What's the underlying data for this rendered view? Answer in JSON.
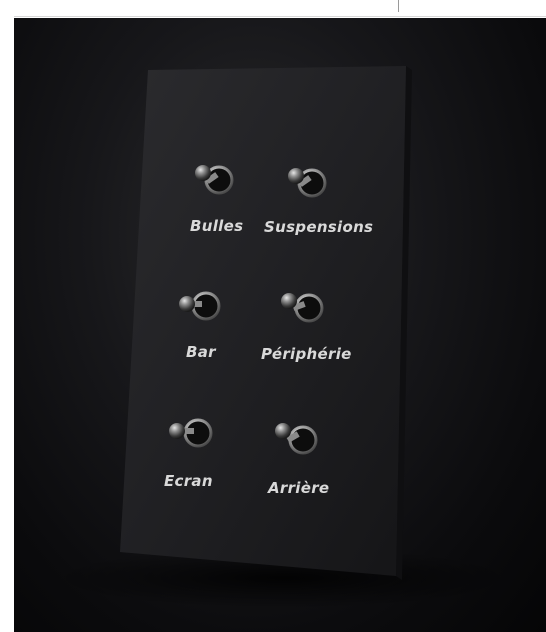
{
  "image": {
    "subject": "panel-with-six-toggle-switches"
  },
  "panel": {
    "color": "#1f1f22",
    "labels": [
      "Bulles",
      "Suspensions",
      "Bar",
      "Périphérie",
      "Ecran",
      "Arrière"
    ]
  },
  "colors": {
    "background": "#0b0b0d",
    "panel": "#1f1f22",
    "label_text": "#d9d9d9",
    "metal": "#bfbfbf"
  },
  "icons": {
    "switch": "toggle-switch-icon"
  }
}
